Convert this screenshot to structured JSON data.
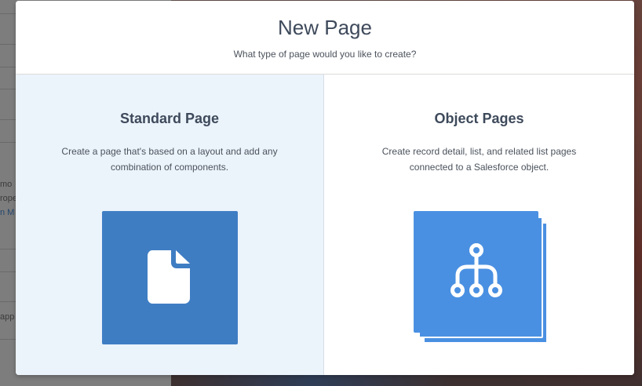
{
  "background": {
    "snippets": [
      "mo",
      "rope",
      "n M",
      "app"
    ]
  },
  "modal": {
    "title": "New Page",
    "subtitle": "What type of page would you like to create?"
  },
  "options": {
    "standard": {
      "title": "Standard Page",
      "description": "Create a page that's based on a layout and add any combination of components.",
      "icon": "document-icon",
      "tile_color": "#3f7dc3",
      "selected": true
    },
    "object": {
      "title": "Object Pages",
      "description": "Create record detail, list, and related list pages connected to a Salesforce object.",
      "icon": "hierarchy-icon",
      "tile_color": "#4a90e2",
      "selected": false
    }
  },
  "colors": {
    "selected_background": "#ebf3fb",
    "heading_text": "#3e4a5b",
    "body_text": "#4b525c"
  }
}
